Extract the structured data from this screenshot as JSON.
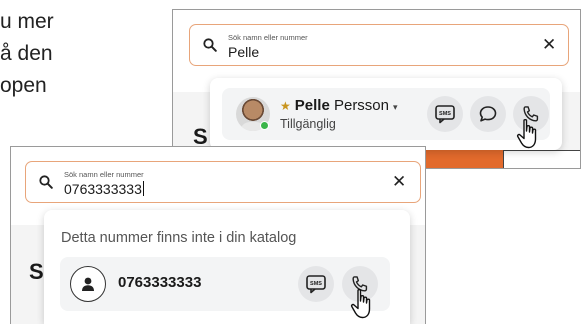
{
  "background_text": [
    "u mer",
    "å den",
    "open"
  ],
  "window1": {
    "search": {
      "label": "Sök namn eller nummer",
      "value": "Pelle"
    },
    "heading_partial": "S",
    "contact": {
      "first_name": "Pelle",
      "last_name": "Persson",
      "status": "Tillgänglig",
      "presence_color": "#3bb54a",
      "favorite_icon": "star-icon"
    }
  },
  "window2": {
    "search": {
      "label": "Sök namn eller nummer",
      "value": "0763333333"
    },
    "heading_partial": "S",
    "not_found_message": "Detta nummer finns inte i din katalog",
    "number": "0763333333"
  },
  "icons": {
    "sms": "SMS",
    "search": "search-icon",
    "close": "close-icon",
    "chat": "chat-bubble-icon",
    "call": "phone-icon",
    "cursor": "hand-cursor-icon"
  },
  "colors": {
    "search_border": "#e8a57a",
    "accent": "#e26a2c",
    "button_bg": "#e4e5e7"
  }
}
